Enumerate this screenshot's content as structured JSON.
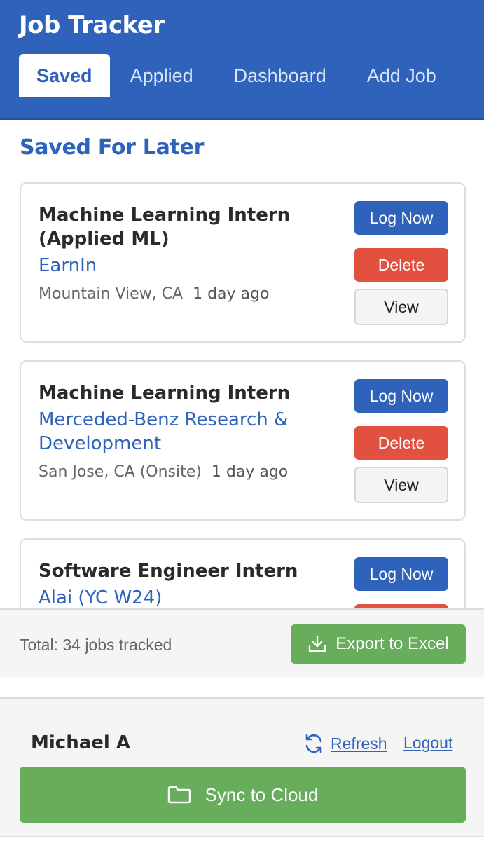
{
  "app": {
    "title": "Job Tracker"
  },
  "tabs": [
    {
      "label": "Saved",
      "active": true
    },
    {
      "label": "Applied",
      "active": false
    },
    {
      "label": "Dashboard",
      "active": false
    },
    {
      "label": "Add Job",
      "active": false
    }
  ],
  "section": {
    "title": "Saved For Later"
  },
  "jobs": [
    {
      "title": "Machine Learning Intern (Applied ML)",
      "company": "EarnIn",
      "location": "Mountain View, CA",
      "posted": "1 day ago"
    },
    {
      "title": "Machine Learning Intern",
      "company": "Merceded-Benz Research & Development",
      "location": "San Jose, CA (Onsite)",
      "posted": "1 day ago"
    },
    {
      "title": "Software Engineer Intern",
      "company": "Alai (YC W24)",
      "location": "",
      "posted": ""
    }
  ],
  "actions": {
    "log_label": "Log Now",
    "delete_label": "Delete",
    "view_label": "View"
  },
  "summary": {
    "total_text": "Total: 34 jobs tracked",
    "export_label": "Export to Excel"
  },
  "footer": {
    "user_name": "Michael A",
    "refresh_label": "Refresh",
    "logout_label": "Logout",
    "sync_label": "Sync to Cloud"
  },
  "colors": {
    "primary": "#2f62bb",
    "danger": "#e2503f",
    "success": "#67ad5b"
  },
  "icons": {
    "export": "download-icon",
    "refresh": "refresh-icon",
    "sync": "folder-icon"
  }
}
